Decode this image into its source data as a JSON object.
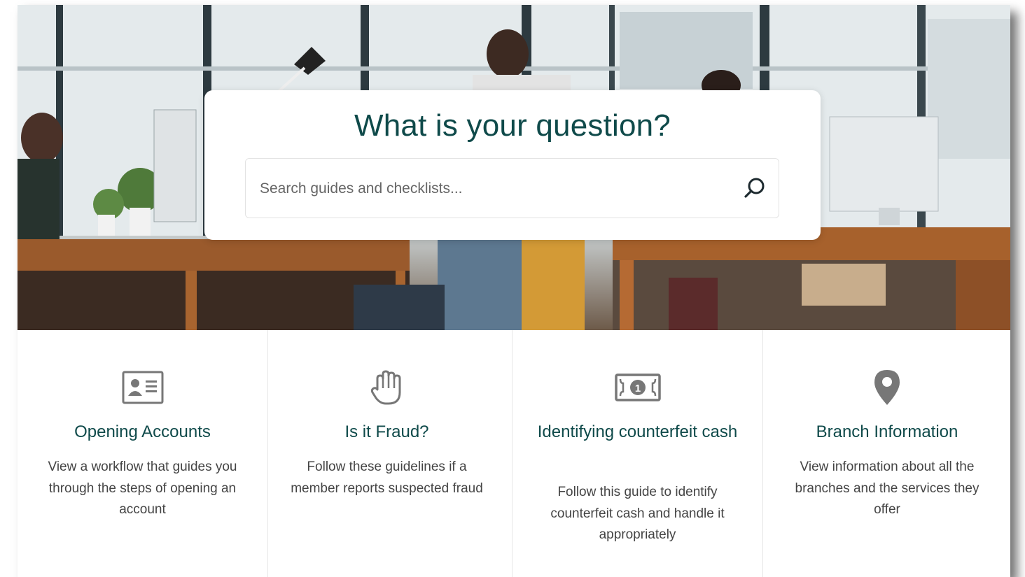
{
  "search": {
    "title": "What is your question?",
    "placeholder": "Search guides and checklists...",
    "button_icon": "search-icon"
  },
  "cards": [
    {
      "icon": "id-card-icon",
      "title": "Opening Accounts",
      "description": "View a workflow that guides you through the steps of opening an account"
    },
    {
      "icon": "raised-hand-icon",
      "title": "Is it Fraud?",
      "description": "Follow these guidelines if a member reports suspected fraud"
    },
    {
      "icon": "banknote-icon",
      "title": "Identifying counterfeit cash",
      "description": "Follow this guide to identify counterfeit cash and handle it appropriately"
    },
    {
      "icon": "map-pin-icon",
      "title": "Branch Information",
      "description": "View information about all the branches and the services they offer"
    }
  ],
  "colors": {
    "accent": "#0f4a4a",
    "icon_gray": "#777777",
    "text": "#444444"
  }
}
